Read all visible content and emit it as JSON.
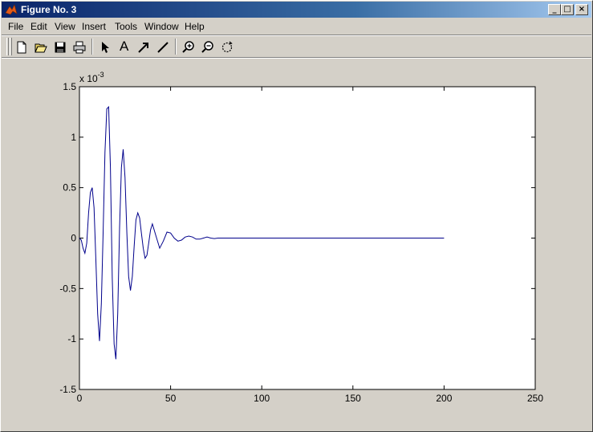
{
  "window": {
    "title": "Figure No. 3"
  },
  "menu": [
    "File",
    "Edit",
    "View",
    "Insert",
    "Tools",
    "Window",
    "Help"
  ],
  "toolbar": {
    "buttons": [
      "new-figure",
      "open-file",
      "save",
      "print",
      "select-arrow",
      "insert-text",
      "insert-arrow",
      "insert-line",
      "zoom-in",
      "zoom-out",
      "rotate-3d"
    ],
    "text_tool_label": "A"
  },
  "chart_data": {
    "type": "line",
    "title": "",
    "xlabel": "",
    "ylabel": "",
    "y_exponent_label": "x 10",
    "y_exponent_power": "-3",
    "xlim": [
      0,
      250
    ],
    "ylim": [
      -1.5,
      1.5
    ],
    "xticks": [
      0,
      50,
      100,
      150,
      200,
      250
    ],
    "yticks": [
      -1.5,
      -1,
      -0.5,
      0,
      0.5,
      1,
      1.5
    ],
    "xtick_labels": [
      "0",
      "50",
      "100",
      "150",
      "200",
      "250"
    ],
    "ytick_labels": [
      "-1.5",
      "-1",
      "-0.5",
      "0",
      "0.5",
      "1",
      "1.5"
    ],
    "grid": false,
    "series_color": "#00008b",
    "series": [
      {
        "x": [
          0,
          1,
          2,
          3,
          4,
          5,
          6,
          7,
          8,
          9,
          10,
          11,
          12,
          13,
          14,
          15,
          16,
          17,
          18,
          19,
          20,
          21,
          22,
          23,
          24,
          25,
          26,
          27,
          28,
          29,
          30,
          31,
          32,
          33,
          34,
          35,
          36,
          37,
          38,
          39,
          40,
          42,
          44,
          46,
          48,
          50,
          52,
          54,
          56,
          58,
          60,
          62,
          64,
          66,
          68,
          70,
          72,
          74,
          76,
          80,
          85,
          90,
          100,
          110,
          120,
          130,
          140,
          150,
          160,
          170,
          180,
          190,
          200
        ],
        "y": [
          0,
          -0.02,
          -0.1,
          -0.15,
          -0.05,
          0.25,
          0.45,
          0.5,
          0.3,
          -0.2,
          -0.75,
          -1.02,
          -0.65,
          0.05,
          0.85,
          1.28,
          1.3,
          0.7,
          -0.4,
          -1.05,
          -1.2,
          -0.75,
          0.1,
          0.7,
          0.88,
          0.6,
          0.05,
          -0.38,
          -0.52,
          -0.38,
          -0.08,
          0.18,
          0.25,
          0.2,
          0.05,
          -0.1,
          -0.2,
          -0.17,
          -0.05,
          0.08,
          0.14,
          0.02,
          -0.1,
          -0.03,
          0.06,
          0.05,
          0.0,
          -0.03,
          -0.02,
          0.01,
          0.02,
          0.01,
          -0.01,
          -0.01,
          0.0,
          0.01,
          0.0,
          -0.005,
          0.0,
          0.0,
          0.0,
          0.0,
          0.0,
          0.0,
          0.0,
          0.0,
          0.0,
          0.0,
          0.0,
          0.0,
          0.0,
          0.0,
          0.0
        ]
      }
    ]
  }
}
